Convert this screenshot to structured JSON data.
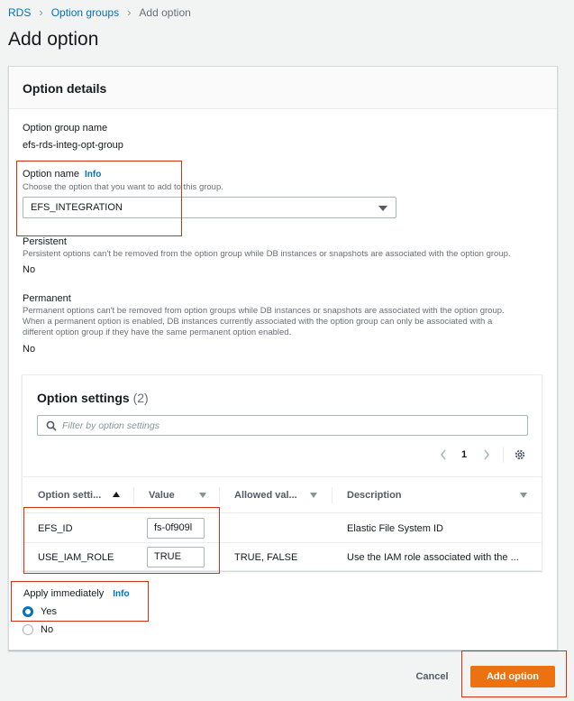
{
  "breadcrumb": {
    "items": [
      "RDS",
      "Option groups"
    ],
    "current": "Add option"
  },
  "page_title": "Add option",
  "details": {
    "title": "Option details",
    "group_name_label": "Option group name",
    "group_name_value": "efs-rds-integ-opt-group",
    "option_name_label": "Option name",
    "info": "Info",
    "option_name_desc": "Choose the option that you want to add to this group.",
    "option_name_value": "EFS_INTEGRATION",
    "persistent_label": "Persistent",
    "persistent_desc": "Persistent options can't be removed from the option group while DB instances or snapshots are associated with the option group.",
    "persistent_value": "No",
    "permanent_label": "Permanent",
    "permanent_desc_1": "Permanent options can't be removed from option groups while DB instances or snapshots are associated with the option group.",
    "permanent_desc_2": "When a permanent option is enabled, DB instances currently associated with the option group can only be associated with a",
    "permanent_desc_3": "different option group if they have the same permanent option enabled.",
    "permanent_value": "No"
  },
  "settings": {
    "title": "Option settings",
    "count": "(2)",
    "filter_placeholder": "Filter by option settings",
    "page": "1",
    "columns": [
      "Option setti...",
      "Value",
      "Allowed val...",
      "Description"
    ],
    "rows": [
      {
        "name": "EFS_ID",
        "value": "fs-0f909l",
        "allowed": "",
        "description": "Elastic File System ID"
      },
      {
        "name": "USE_IAM_ROLE",
        "value": "TRUE",
        "allowed": "TRUE, FALSE",
        "description": "Use the IAM role associated with the ..."
      }
    ]
  },
  "apply": {
    "label": "Apply immediately",
    "info": "Info",
    "yes": "Yes",
    "no": "No",
    "selected": "Yes"
  },
  "actions": {
    "cancel": "Cancel",
    "add": "Add option"
  },
  "colors": {
    "accent": "#ec7211",
    "link": "#0073bb",
    "highlight": "#d13212"
  }
}
